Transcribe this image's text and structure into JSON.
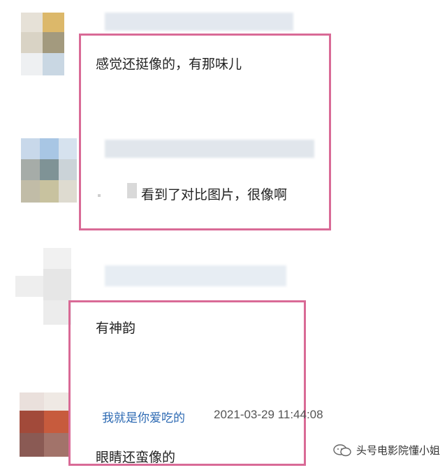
{
  "comments": [
    {
      "text": "感觉还挺像的，有那味儿"
    },
    {
      "text": "看到了对比图片，很像啊"
    },
    {
      "text": "有神韵"
    },
    {
      "user": "我就是你爱吃的",
      "time": "2021-03-29 11:44:08",
      "text": "眼睛还蛮像的"
    }
  ],
  "watermark": {
    "text": "头号电影院懂小姐",
    "icon": "wechat-icon"
  },
  "colors": {
    "frame": "#d96a96",
    "link": "#2d6ab3"
  }
}
